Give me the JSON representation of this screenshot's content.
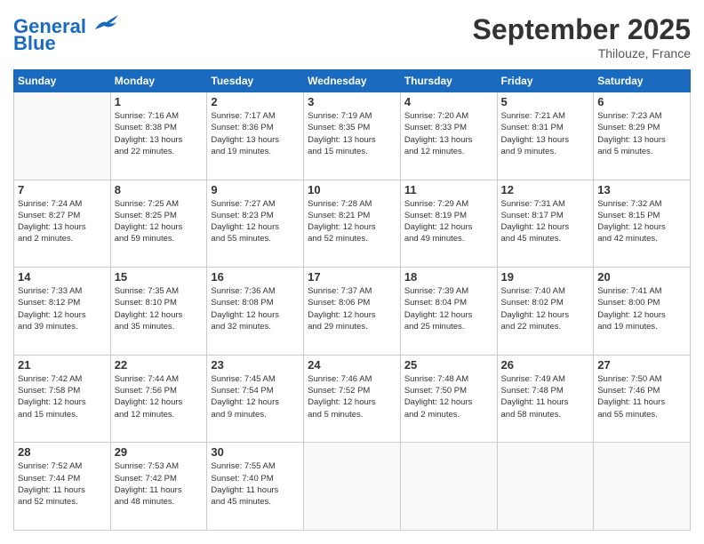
{
  "header": {
    "logo_line1": "General",
    "logo_line2": "Blue",
    "month": "September 2025",
    "location": "Thilouze, France"
  },
  "weekdays": [
    "Sunday",
    "Monday",
    "Tuesday",
    "Wednesday",
    "Thursday",
    "Friday",
    "Saturday"
  ],
  "weeks": [
    [
      {
        "day": "",
        "info": ""
      },
      {
        "day": "1",
        "info": "Sunrise: 7:16 AM\nSunset: 8:38 PM\nDaylight: 13 hours\nand 22 minutes."
      },
      {
        "day": "2",
        "info": "Sunrise: 7:17 AM\nSunset: 8:36 PM\nDaylight: 13 hours\nand 19 minutes."
      },
      {
        "day": "3",
        "info": "Sunrise: 7:19 AM\nSunset: 8:35 PM\nDaylight: 13 hours\nand 15 minutes."
      },
      {
        "day": "4",
        "info": "Sunrise: 7:20 AM\nSunset: 8:33 PM\nDaylight: 13 hours\nand 12 minutes."
      },
      {
        "day": "5",
        "info": "Sunrise: 7:21 AM\nSunset: 8:31 PM\nDaylight: 13 hours\nand 9 minutes."
      },
      {
        "day": "6",
        "info": "Sunrise: 7:23 AM\nSunset: 8:29 PM\nDaylight: 13 hours\nand 5 minutes."
      }
    ],
    [
      {
        "day": "7",
        "info": "Sunrise: 7:24 AM\nSunset: 8:27 PM\nDaylight: 13 hours\nand 2 minutes."
      },
      {
        "day": "8",
        "info": "Sunrise: 7:25 AM\nSunset: 8:25 PM\nDaylight: 12 hours\nand 59 minutes."
      },
      {
        "day": "9",
        "info": "Sunrise: 7:27 AM\nSunset: 8:23 PM\nDaylight: 12 hours\nand 55 minutes."
      },
      {
        "day": "10",
        "info": "Sunrise: 7:28 AM\nSunset: 8:21 PM\nDaylight: 12 hours\nand 52 minutes."
      },
      {
        "day": "11",
        "info": "Sunrise: 7:29 AM\nSunset: 8:19 PM\nDaylight: 12 hours\nand 49 minutes."
      },
      {
        "day": "12",
        "info": "Sunrise: 7:31 AM\nSunset: 8:17 PM\nDaylight: 12 hours\nand 45 minutes."
      },
      {
        "day": "13",
        "info": "Sunrise: 7:32 AM\nSunset: 8:15 PM\nDaylight: 12 hours\nand 42 minutes."
      }
    ],
    [
      {
        "day": "14",
        "info": "Sunrise: 7:33 AM\nSunset: 8:12 PM\nDaylight: 12 hours\nand 39 minutes."
      },
      {
        "day": "15",
        "info": "Sunrise: 7:35 AM\nSunset: 8:10 PM\nDaylight: 12 hours\nand 35 minutes."
      },
      {
        "day": "16",
        "info": "Sunrise: 7:36 AM\nSunset: 8:08 PM\nDaylight: 12 hours\nand 32 minutes."
      },
      {
        "day": "17",
        "info": "Sunrise: 7:37 AM\nSunset: 8:06 PM\nDaylight: 12 hours\nand 29 minutes."
      },
      {
        "day": "18",
        "info": "Sunrise: 7:39 AM\nSunset: 8:04 PM\nDaylight: 12 hours\nand 25 minutes."
      },
      {
        "day": "19",
        "info": "Sunrise: 7:40 AM\nSunset: 8:02 PM\nDaylight: 12 hours\nand 22 minutes."
      },
      {
        "day": "20",
        "info": "Sunrise: 7:41 AM\nSunset: 8:00 PM\nDaylight: 12 hours\nand 19 minutes."
      }
    ],
    [
      {
        "day": "21",
        "info": "Sunrise: 7:42 AM\nSunset: 7:58 PM\nDaylight: 12 hours\nand 15 minutes."
      },
      {
        "day": "22",
        "info": "Sunrise: 7:44 AM\nSunset: 7:56 PM\nDaylight: 12 hours\nand 12 minutes."
      },
      {
        "day": "23",
        "info": "Sunrise: 7:45 AM\nSunset: 7:54 PM\nDaylight: 12 hours\nand 9 minutes."
      },
      {
        "day": "24",
        "info": "Sunrise: 7:46 AM\nSunset: 7:52 PM\nDaylight: 12 hours\nand 5 minutes."
      },
      {
        "day": "25",
        "info": "Sunrise: 7:48 AM\nSunset: 7:50 PM\nDaylight: 12 hours\nand 2 minutes."
      },
      {
        "day": "26",
        "info": "Sunrise: 7:49 AM\nSunset: 7:48 PM\nDaylight: 11 hours\nand 58 minutes."
      },
      {
        "day": "27",
        "info": "Sunrise: 7:50 AM\nSunset: 7:46 PM\nDaylight: 11 hours\nand 55 minutes."
      }
    ],
    [
      {
        "day": "28",
        "info": "Sunrise: 7:52 AM\nSunset: 7:44 PM\nDaylight: 11 hours\nand 52 minutes."
      },
      {
        "day": "29",
        "info": "Sunrise: 7:53 AM\nSunset: 7:42 PM\nDaylight: 11 hours\nand 48 minutes."
      },
      {
        "day": "30",
        "info": "Sunrise: 7:55 AM\nSunset: 7:40 PM\nDaylight: 11 hours\nand 45 minutes."
      },
      {
        "day": "",
        "info": ""
      },
      {
        "day": "",
        "info": ""
      },
      {
        "day": "",
        "info": ""
      },
      {
        "day": "",
        "info": ""
      }
    ]
  ]
}
